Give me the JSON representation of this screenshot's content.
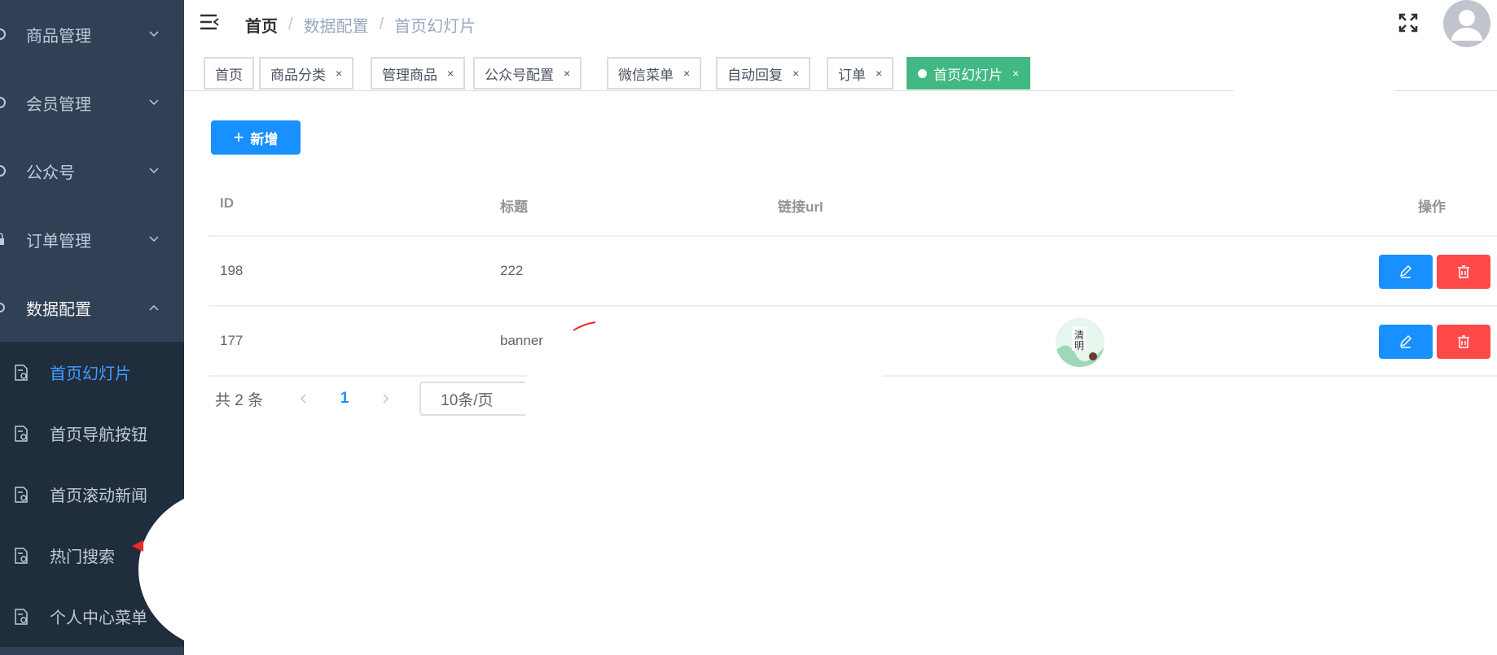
{
  "sidebar": {
    "menus": [
      {
        "label": "商品管理",
        "icon": "menu-icon"
      },
      {
        "label": "会员管理",
        "icon": "menu-icon"
      },
      {
        "label": "公众号",
        "icon": "menu-icon"
      },
      {
        "label": "订单管理",
        "icon": "menu-icon"
      },
      {
        "label": "数据配置",
        "icon": "menu-icon"
      }
    ],
    "submenu": [
      {
        "label": "首页幻灯片",
        "active": true
      },
      {
        "label": "首页导航按钮"
      },
      {
        "label": "首页滚动新闻"
      },
      {
        "label": "热门搜索"
      },
      {
        "label": "个人中心菜单"
      }
    ]
  },
  "breadcrumb": [
    "首页",
    "数据配置",
    "首页幻灯片"
  ],
  "tags": [
    {
      "label": "首页"
    },
    {
      "label": "商品分类"
    },
    {
      "label": "管理商品"
    },
    {
      "label": "公众号配置"
    },
    {
      "label": "微信菜单"
    },
    {
      "label": "自动回复"
    },
    {
      "label": "订单"
    },
    {
      "label": "首页幻灯片",
      "active": true
    }
  ],
  "tag_close": "×",
  "toolbar": {
    "add_label": "新增",
    "add_icon": "+"
  },
  "table": {
    "headers": {
      "id": "ID",
      "title": "标题",
      "url": "链接url",
      "actions": "操作"
    },
    "rows": [
      {
        "id": "198",
        "title": "222",
        "url": "",
        "image": false
      },
      {
        "id": "177",
        "title": "banner",
        "url": "",
        "image": true
      }
    ]
  },
  "pagination": {
    "total": "共 2 条",
    "current": "1",
    "page_size": "10条/页"
  },
  "colors": {
    "sidebar_bg": "#304156",
    "submenu_bg": "#1f2d3d",
    "primary": "#1890ff",
    "danger": "#ff4949",
    "active_tag": "#42b983"
  }
}
